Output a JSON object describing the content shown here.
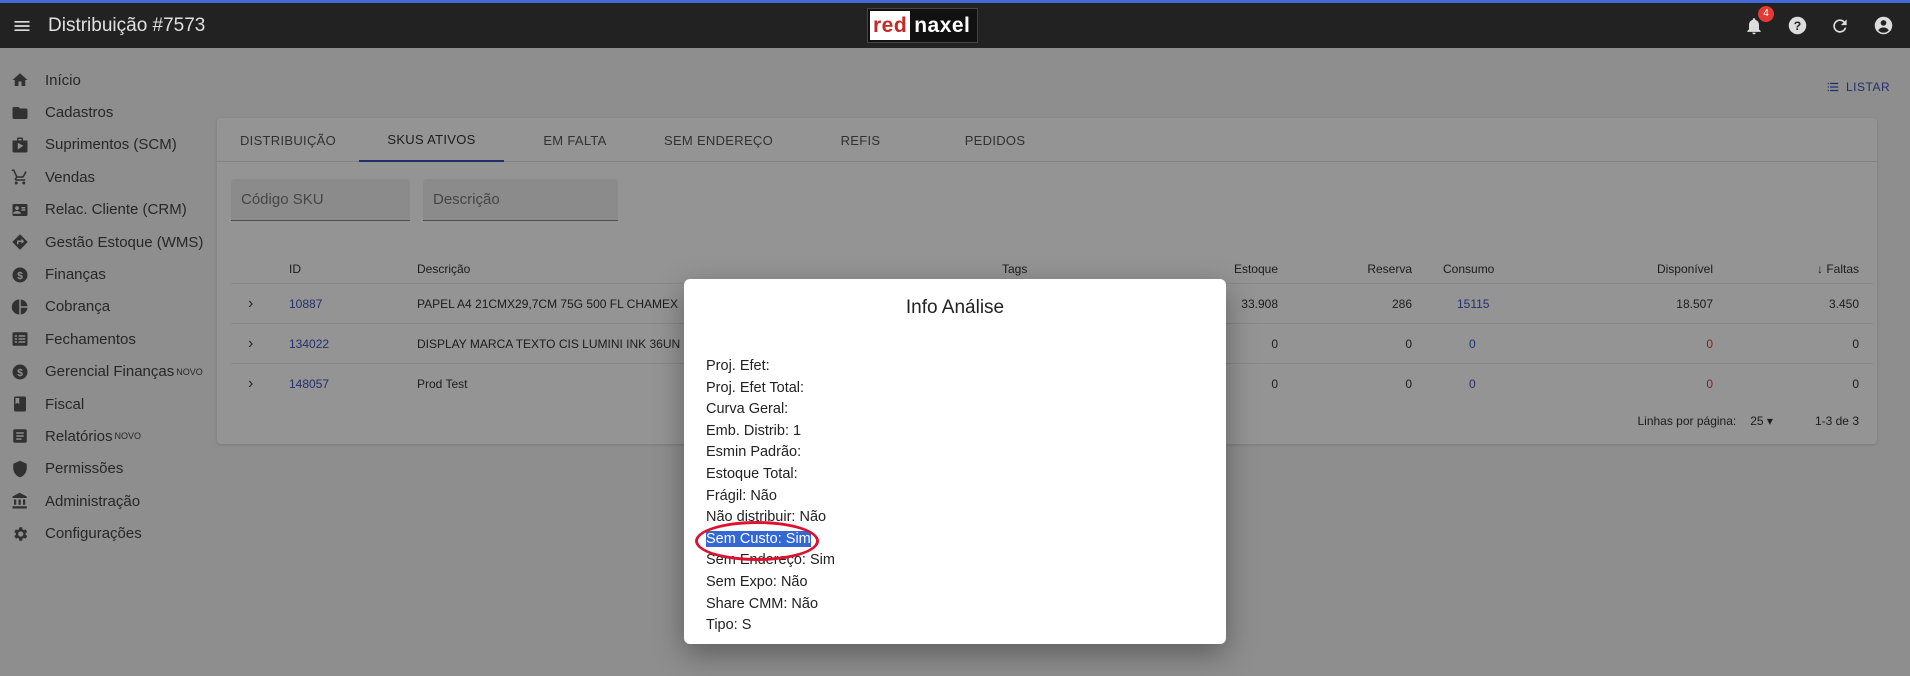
{
  "header": {
    "title": "Distribuição #7573",
    "logo_left": "red",
    "logo_right": "naxel",
    "notification_count": "4"
  },
  "sidebar": {
    "items": [
      {
        "label": "Início",
        "icon": "home-icon"
      },
      {
        "label": "Cadastros",
        "icon": "folder-icon"
      },
      {
        "label": "Suprimentos (SCM)",
        "icon": "bag-icon"
      },
      {
        "label": "Vendas",
        "icon": "cart-icon"
      },
      {
        "label": "Relac. Cliente (CRM)",
        "icon": "contact-card-icon"
      },
      {
        "label": "Gestão Estoque (WMS)",
        "icon": "directions-icon"
      },
      {
        "label": "Finanças",
        "icon": "dollar-icon"
      },
      {
        "label": "Cobrança",
        "icon": "pie-chart-icon"
      },
      {
        "label": "Fechamentos",
        "icon": "list-box-icon"
      },
      {
        "label": "Gerencial Finanças",
        "icon": "dollar-icon",
        "badge": "NOVO"
      },
      {
        "label": "Fiscal",
        "icon": "book-icon"
      },
      {
        "label": "Relatórios",
        "icon": "report-icon",
        "badge": "NOVO"
      },
      {
        "label": "Permissões",
        "icon": "shield-icon"
      },
      {
        "label": "Administração",
        "icon": "bank-icon"
      },
      {
        "label": "Configurações",
        "icon": "gear-icon"
      }
    ]
  },
  "list_button": "LISTAR",
  "tabs": [
    "DISTRIBUIÇÃO",
    "SKUS ATIVOS",
    "EM FALTA",
    "SEM ENDEREÇO",
    "REFIS",
    "PEDIDOS"
  ],
  "active_tab": "SKUS ATIVOS",
  "filters": {
    "sku_placeholder": "Código SKU",
    "desc_placeholder": "Descrição"
  },
  "table": {
    "headers": {
      "id": "ID",
      "descricao": "Descrição",
      "tags": "Tags",
      "estoque": "Estoque",
      "reserva": "Reserva",
      "consumo": "Consumo",
      "disponivel": "Disponível",
      "faltas": "Faltas"
    },
    "rows": [
      {
        "id": "10887",
        "descricao": "PAPEL A4 21CMX29,7CM 75G 500 FL CHAMEX",
        "estoque": "33.908",
        "reserva": "286",
        "consumo": "15115",
        "disponivel": "18.507",
        "faltas": "3.450"
      },
      {
        "id": "134022",
        "descricao": "DISPLAY MARCA TEXTO CIS LUMINI INK 36UN",
        "estoque": "0",
        "reserva": "0",
        "consumo": "0",
        "disponivel": "0",
        "faltas": "0"
      },
      {
        "id": "148057",
        "descricao": "Prod Test",
        "estoque": "0",
        "reserva": "0",
        "consumo": "0",
        "disponivel": "0",
        "faltas": "0"
      }
    ]
  },
  "pagination": {
    "rows_label": "Linhas por página:",
    "rows_value": "25",
    "range": "1-3 de 3"
  },
  "dialog": {
    "title": "Info Análise",
    "lines": [
      "Proj. Efet:",
      "Proj. Efet Total:",
      "Curva Geral:",
      "Emb. Distrib: 1",
      "Esmin Padrão:",
      "Estoque Total:",
      "Frágil: Não",
      "Não distribuir: Não",
      "Sem Custo: Sim",
      "Sem Endereço: Sim",
      "Sem Expo: Não",
      "Share CMM: Não",
      "Tipo: S"
    ]
  },
  "colors": {
    "accent": "#3f51b5",
    "highlight": "#3367d6",
    "annotation": "#e0102f",
    "appbar": "#222222"
  }
}
